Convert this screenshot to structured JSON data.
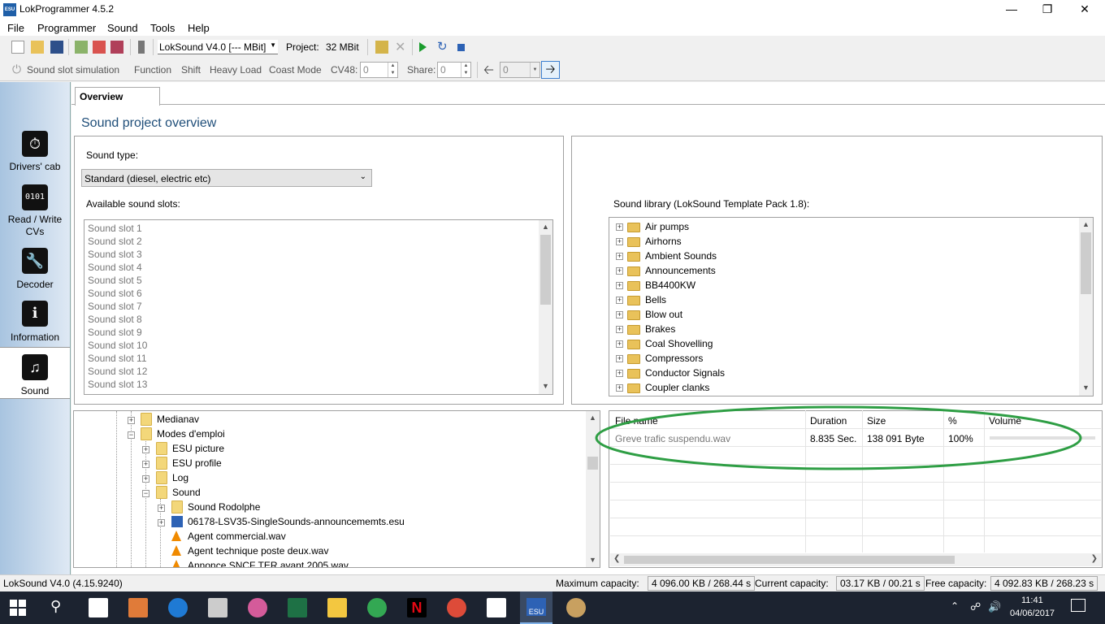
{
  "window": {
    "title": "LokProgrammer 4.5.2",
    "app_icon_text": "ESU"
  },
  "menu": [
    "File",
    "Programmer",
    "Sound",
    "Tools",
    "Help"
  ],
  "toolbar1": {
    "decoder_select": "LokSound V4.0 [--- MBit]",
    "project_label": "Project:",
    "project_value": "32 MBit"
  },
  "toolbar2": {
    "sound_slot_simulation": "Sound slot simulation",
    "function": "Function",
    "shift": "Shift",
    "heavy_load": "Heavy Load",
    "coast_mode": "Coast Mode",
    "cv48_label": "CV48:",
    "cv48_value": "0",
    "share_label": "Share:",
    "share_value": "0",
    "nav_value": "0"
  },
  "leftnav": [
    {
      "label": "Drivers' cab",
      "icon": "gauge-icon"
    },
    {
      "label": "Read / Write CVs",
      "icon": "binary-icon"
    },
    {
      "label": "Decoder",
      "icon": "wrench-icon"
    },
    {
      "label": "Information",
      "icon": "info-icon"
    },
    {
      "label": "Sound",
      "icon": "music-note-icon"
    }
  ],
  "tab": "Overview",
  "heading": "Sound project overview",
  "sound_type_label": "Sound type:",
  "sound_type_value": "Standard (diesel, electric etc)",
  "available_slots_label": "Available sound slots:",
  "slots": [
    "Sound slot 1",
    "Sound slot 2",
    "Sound slot 3",
    "Sound slot 4",
    "Sound slot 5",
    "Sound slot 6",
    "Sound slot 7",
    "Sound slot 8",
    "Sound slot 9",
    "Sound slot 10",
    "Sound slot 11",
    "Sound slot 12",
    "Sound slot 13"
  ],
  "library_label": "Sound library (LokSound Template Pack 1.8):",
  "library": [
    "Air pumps",
    "Airhorns",
    "Ambient Sounds",
    "Announcements",
    "BB4400KW",
    "Bells",
    "Blow out",
    "Brakes",
    "Coal Shovelling",
    "Compressors",
    "Conductor Signals",
    "Coupler clanks"
  ],
  "filetree": {
    "medianav": "Medianav",
    "modes": "Modes d'emploi",
    "esu_picture": "ESU picture",
    "esu_profile": "ESU profile",
    "log": "Log",
    "sound": "Sound",
    "sound_rodolphe": "Sound Rodolphe",
    "esu_file": "06178-LSV35-SingleSounds-announcememts.esu",
    "wav1": "Agent commercial.wav",
    "wav2": "Agent technique poste deux.wav",
    "wav3": "Annonce SNCF TER avant 2005.wav"
  },
  "table": {
    "headers": [
      "File name",
      "Duration",
      "Size",
      "%",
      "Volume"
    ],
    "row": {
      "name": "Greve trafic suspendu.wav",
      "duration": "8.835 Sec.",
      "size": "138 091 Byte",
      "percent": "100%"
    }
  },
  "status": {
    "decoder": "LokSound V4.0 (4.15.9240)",
    "max_label": "Maximum capacity:",
    "max_value": "4 096.00 KB / 268.44 s",
    "current_label": "Current capacity:",
    "current_value": "03.17 KB / 00.21 s",
    "free_label": "Free capacity:",
    "free_value": "4 092.83 KB / 268.23 s"
  },
  "taskbar": {
    "time": "11:41",
    "date": "04/06/2017",
    "esu_label": "ESU"
  },
  "colors": {
    "heading": "#1f4e79",
    "annotation": "#2e9e44",
    "nav_gradient_start": "#a8c4e0"
  }
}
